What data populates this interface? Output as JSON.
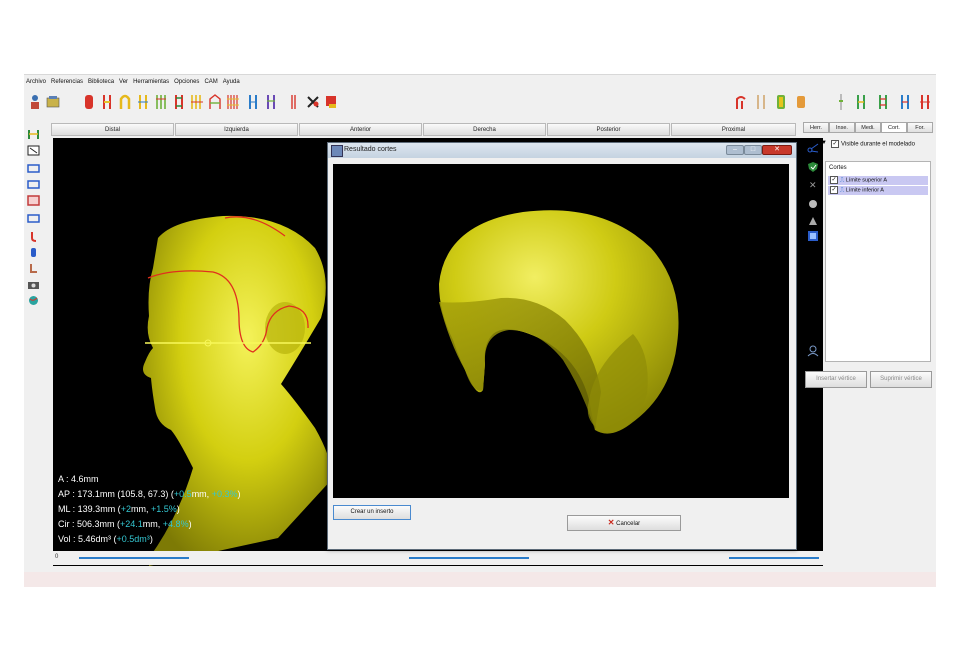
{
  "menu": [
    "Archivo",
    "Referencias",
    "Biblioteca",
    "Ver",
    "Herramientas",
    "Opciones",
    "CAM",
    "Ayuda"
  ],
  "view_tabs": [
    "Distal",
    "Izquierda",
    "Anterior",
    "Derecha",
    "Posterior",
    "Proximal"
  ],
  "measurements": {
    "a": "A : 4.6mm",
    "ap": {
      "prefix": "AP : 173.1mm (105.8, 67.3) (",
      "d1": "+0.5",
      "mid": "mm, ",
      "d2": "+0.3%",
      "suffix": ")"
    },
    "ml": {
      "prefix": "ML : 139.3mm (",
      "d1": "+2",
      "mid": "mm, ",
      "d2": "+1.5%",
      "suffix": ")"
    },
    "cir": {
      "prefix": "Cir : 506.3mm (",
      "d1": "+24.1",
      "mid": "mm, ",
      "d2": "+4.8%",
      "suffix": ")"
    },
    "vol": {
      "prefix": "Vol : 5.46dm³ (",
      "d1": "+0.5dm³",
      "suffix": ")"
    }
  },
  "bottom_scale": "0",
  "dialog": {
    "title": "Resultado cortes",
    "insert_button": "Crear un inserto",
    "cancel_button": "Cancelar"
  },
  "right_panel": {
    "tabs": [
      "Herr.",
      "Inse.",
      "Medi.",
      "Cort.",
      "For."
    ],
    "visible_label": "Visible durante el modelado",
    "visible_checked": true,
    "list_title": "Cortes",
    "items": [
      {
        "label": "Límite superior A",
        "checked": true
      },
      {
        "label": "Límite inferior A",
        "checked": true
      }
    ],
    "insert_vertex": "Insertar vértice",
    "delete_vertex": "Suprimir vértice"
  },
  "colors": {
    "model_yellow": "#d3cf10",
    "cut_line_red": "#e0301e",
    "highlight_cyan": "#34c7d2",
    "selection_blue": "#c9c8f2"
  }
}
